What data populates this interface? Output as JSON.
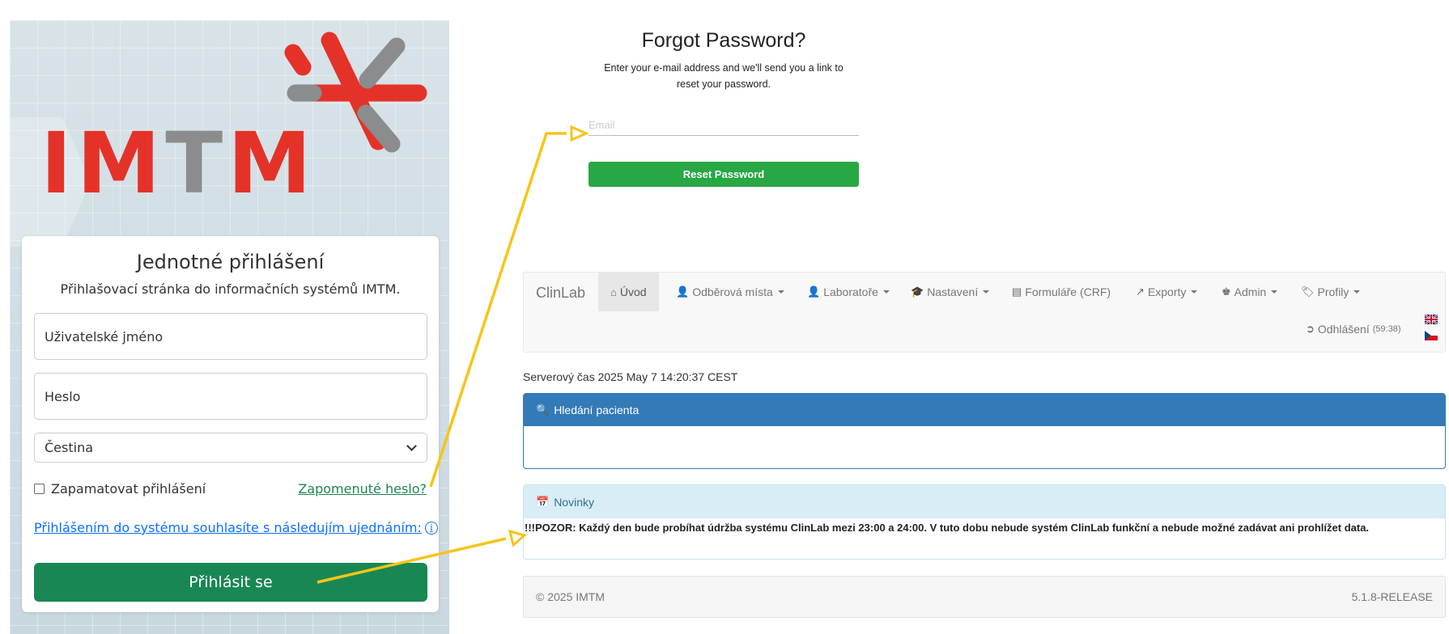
{
  "login": {
    "logo_text": "IMTM",
    "title": "Jednotné přihlášení",
    "subtitle": "Přihlašovací stránka do informačních systémů IMTM.",
    "username_placeholder": "Uživatelské jméno",
    "password_placeholder": "Heslo",
    "language_selected": "Čestina",
    "remember_label": "Zapamatovat přihlášení",
    "forgot_link": "Zapomenuté heslo?",
    "terms_link": "Přihlášením do systému souhlasíte s následujím ujednáním:",
    "info_icon": "i",
    "login_button": "Přihlásit se",
    "colors": {
      "brand_red": "#e53228",
      "brand_gray": "#8a8c8e",
      "button_green": "#198754"
    }
  },
  "forgot": {
    "title": "Forgot Password?",
    "description_line1": "Enter your e-mail address and we'll send you a link to",
    "description_line2": "reset your password.",
    "email_placeholder": "Email",
    "reset_button": "Reset Password"
  },
  "clinlab": {
    "brand": "ClinLab",
    "nav": [
      {
        "label": "Úvod",
        "icon": "home-icon"
      },
      {
        "label": "Odběrová místa",
        "icon": "user-icon"
      },
      {
        "label": "Laboratoře",
        "icon": "user-icon"
      },
      {
        "label": "Nastavení",
        "icon": "graduation-cap-icon"
      },
      {
        "label": "Formuláře (CRF)",
        "icon": "list-alt-icon"
      },
      {
        "label": "Exporty",
        "icon": "share-icon"
      },
      {
        "label": "Admin",
        "icon": "king-icon"
      },
      {
        "label": "Profily",
        "icon": "tags-icon"
      }
    ],
    "logout_label": "Odhlášení",
    "logout_timer": "(59:38)",
    "server_time": "Serverový čas 2025 May 7 14:20:37 CEST",
    "search_panel_title": "Hledání pacienta",
    "news_panel_title": "Novinky",
    "news_text": "!!!POZOR: Každý den bude probíhat údržba systému ClinLab mezi 23:00 a 24:00. V tuto dobu nebude systém ClinLab funkční a nebude možné zadávat ani prohlížet data.",
    "footer_copyright": "© 2025 IMTM",
    "footer_version": "5.1.8-RELEASE"
  },
  "annotation_color": "#f5c518"
}
